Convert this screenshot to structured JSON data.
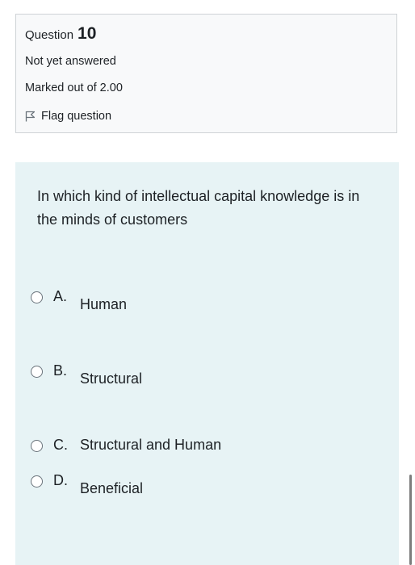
{
  "question_info": {
    "label": "Question",
    "number": "10",
    "state": "Not yet answered",
    "grade": "Marked out of 2.00",
    "flag_label": "Flag question",
    "flag_icon": "flag-icon"
  },
  "question": {
    "text": "In which kind of intellectual capital knowledge is in the minds of customers",
    "options": [
      {
        "letter": "A.",
        "label": "Human"
      },
      {
        "letter": "B.",
        "label": "Structural"
      },
      {
        "letter": "C.",
        "label": "Structural and Human"
      },
      {
        "letter": "D.",
        "label": "Beneficial"
      }
    ]
  },
  "colors": {
    "content_background": "#e7f3f5",
    "info_background": "#f8f9fa",
    "text": "#1d2125"
  }
}
